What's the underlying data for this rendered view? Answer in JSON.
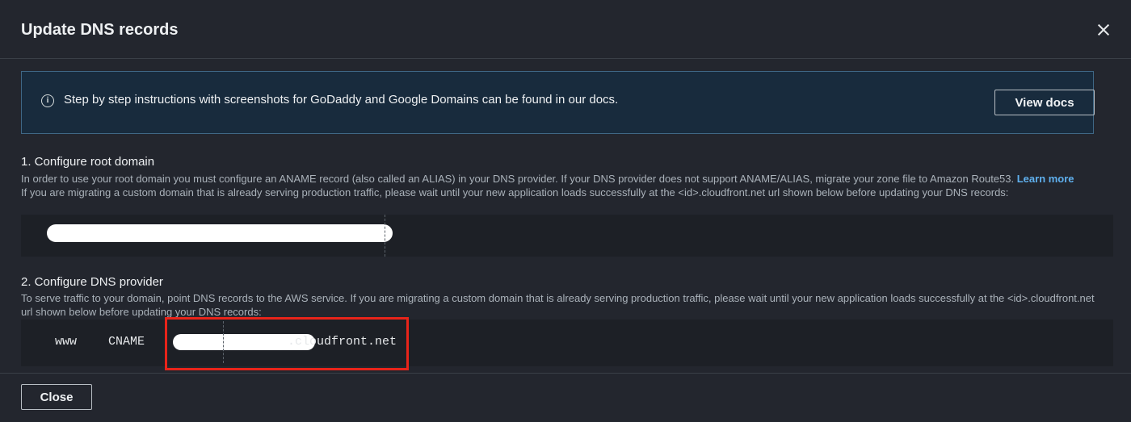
{
  "modal": {
    "title": "Update DNS records",
    "close_icon": "close-x-icon"
  },
  "info": {
    "icon": "info-circle-icon",
    "text": "Step by step instructions with screenshots for GoDaddy and Google Domains can be found in our docs.",
    "button_label": "View docs"
  },
  "section1": {
    "title": "1. Configure root domain",
    "desc_part1": "In order to use your root domain you must configure an ANAME record (also called an ALIAS) in your DNS provider. If your DNS provider does not support ANAME/ALIAS, migrate your zone file to Amazon Route53.",
    "learn_more": "Learn more",
    "desc_part2": "If you are migrating a custom domain that is already serving production traffic, please wait until your new application loads successfully at the <id>.cloudfront.net url shown below before updating your DNS records:"
  },
  "section2": {
    "title": "2. Configure DNS provider",
    "desc": "To serve traffic to your domain, point DNS records to the AWS            service. If you are migrating a custom domain that is already serving production traffic, please wait until your new application loads successfully at the <id>.cloudfront.net url shown below before updating your DNS records:",
    "record": {
      "host": "www",
      "type": "CNAME",
      "value_suffix": ".cloudfront.net"
    }
  },
  "footer": {
    "close_label": "Close"
  },
  "colors": {
    "background": "#23262e",
    "info_bg": "#182b3d",
    "link": "#5fb0ee",
    "highlight": "#e8241a"
  }
}
